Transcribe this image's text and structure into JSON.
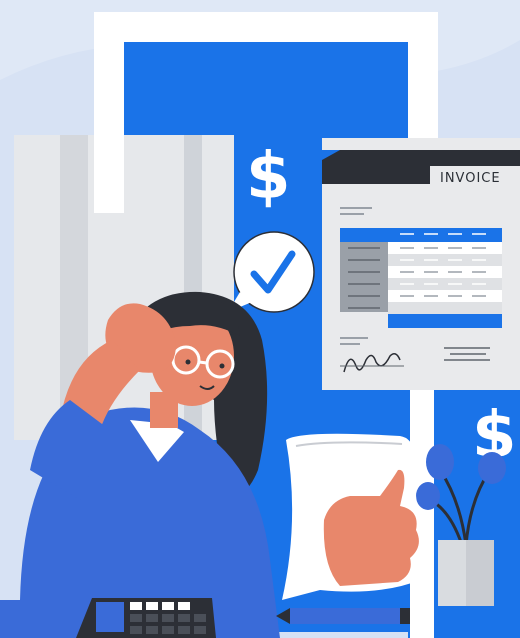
{
  "invoice": {
    "title": "INVOICE"
  },
  "symbols": {
    "dollar_left": "$",
    "dollar_right": "$"
  },
  "colors": {
    "background": "#dfe8f6",
    "accent_blue": "#1a73e8",
    "white": "#ffffff",
    "skin": "#e8876b",
    "hair": "#2c2f36",
    "shirt": "#3a6bd8"
  },
  "icons": [
    "checkmark-icon",
    "dollar-icon",
    "calculator-icon",
    "pencil-icon",
    "plant-icon",
    "signature-icon"
  ]
}
